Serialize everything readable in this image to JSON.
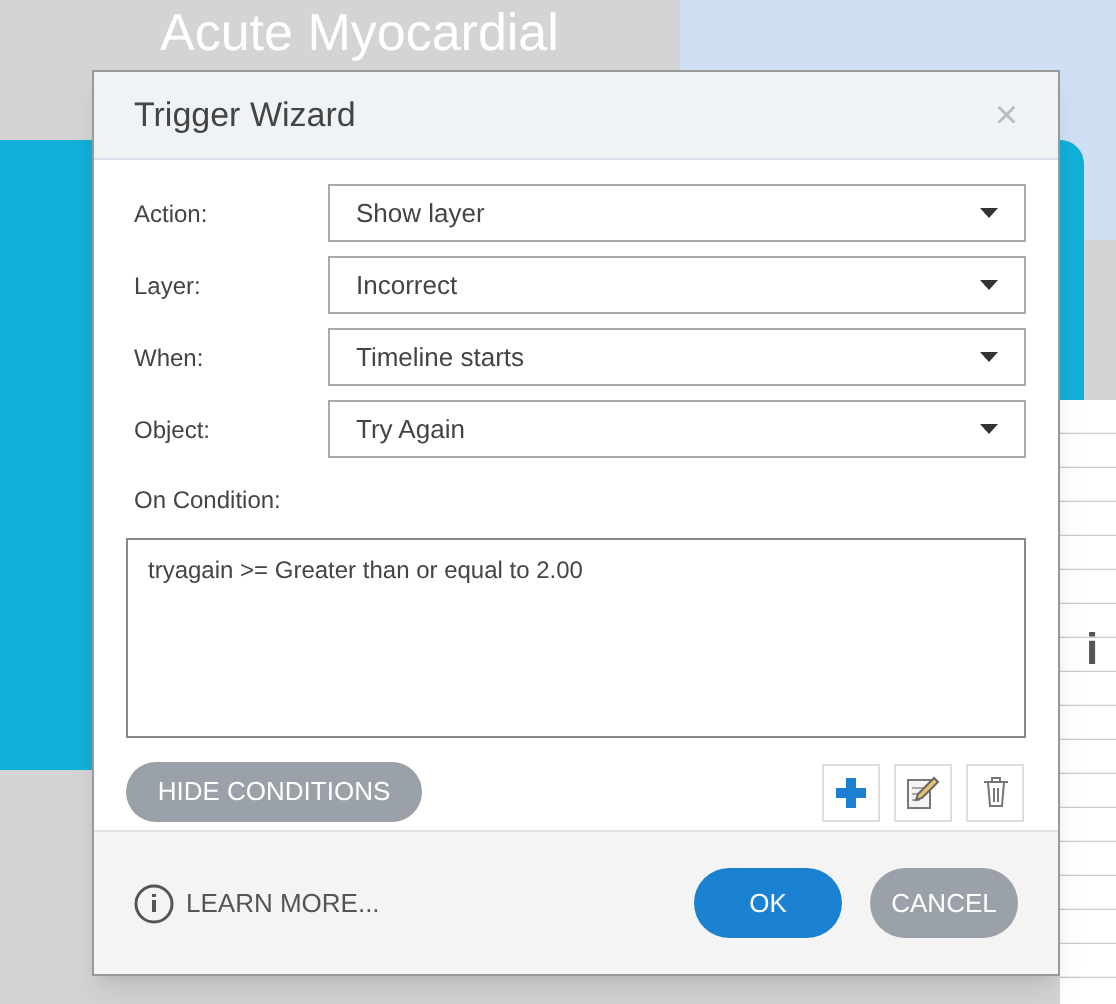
{
  "background": {
    "slide_title": "Acute Myocardial",
    "partial_text": "i"
  },
  "dialog": {
    "title": "Trigger Wizard",
    "close": "×",
    "fields": [
      {
        "label": "Action:",
        "value": "Show layer"
      },
      {
        "label": "Layer:",
        "value": "Incorrect"
      },
      {
        "label": "When:",
        "value": "Timeline starts"
      },
      {
        "label": "Object:",
        "value": "Try Again"
      }
    ],
    "condition_label": "On Condition:",
    "conditions": [
      "tryagain >= Greater than or equal to 2.00"
    ],
    "hide_conditions": "HIDE CONDITIONS",
    "learn_more": "LEARN MORE...",
    "ok": "OK",
    "cancel": "CANCEL"
  }
}
